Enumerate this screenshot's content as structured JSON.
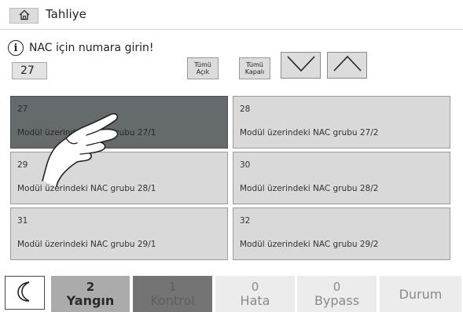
{
  "header": {
    "title": "Tahliye",
    "home_icon": "home-icon"
  },
  "instruction": {
    "icon": "info-icon",
    "icon_glyph": "i",
    "text": "NAC için numara girin!"
  },
  "number_input": {
    "value": "27"
  },
  "buttons": {
    "all_on": "Tümü\nAçık",
    "all_off": "Tümü\nKapalı",
    "scroll_down_icon": "chevron-down-icon",
    "scroll_up_icon": "chevron-up-icon"
  },
  "nac_groups": [
    {
      "number": "27",
      "description": "Modül üzerindeki NAC grubu 27/1",
      "selected": true
    },
    {
      "number": "28",
      "description": "Modül üzerindeki NAC grubu 27/2",
      "selected": false
    },
    {
      "number": "29",
      "description": "Modül üzerindeki NAC grubu 28/1",
      "selected": false
    },
    {
      "number": "30",
      "description": "Modül üzerindeki NAC grubu 28/2",
      "selected": false
    },
    {
      "number": "31",
      "description": "Modül üzerindeki NAC grubu 29/1",
      "selected": false
    },
    {
      "number": "32",
      "description": "Modül üzerindeki NAC grubu 29/2",
      "selected": false
    }
  ],
  "status_bar": {
    "standby_icon": "moon-icon",
    "yangin": {
      "count": "2",
      "label": "Yangın"
    },
    "kontrol": {
      "count": "1",
      "label": "Kontrol"
    },
    "hata": {
      "count": "0",
      "label": "Hata"
    },
    "bypass": {
      "count": "0",
      "label": "Bypass"
    },
    "durum": {
      "label": "Durum"
    }
  },
  "overlay": {
    "pointer": "hand-pointer-icon"
  },
  "colors": {
    "selected_tile": "#656a6c",
    "tile": "#d9d9d9",
    "yangin_bg": "#ababab",
    "kontrol_bg": "#747474",
    "inactive_bg": "#ececec"
  }
}
